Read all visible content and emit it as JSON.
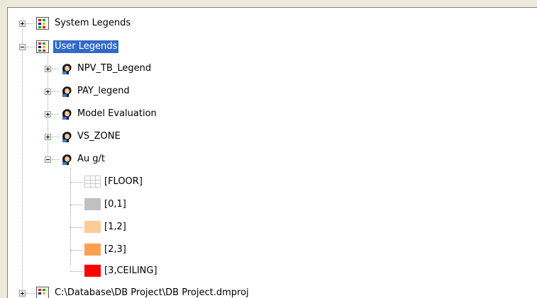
{
  "tree": {
    "system_legends": "System Legends",
    "user_legends": "User Legends",
    "legends": [
      {
        "label": "NPV_TB_Legend",
        "expanded": false
      },
      {
        "label": "PAY_legend",
        "expanded": false
      },
      {
        "label": "Model Evaluation",
        "expanded": false
      },
      {
        "label": "VS_ZONE",
        "expanded": false
      },
      {
        "label": "Au g/t",
        "expanded": true
      }
    ],
    "au_ranges": [
      {
        "label": "[FLOOR]",
        "color": "#ffffff",
        "pattern": "grid"
      },
      {
        "label": "[0,1]",
        "color": "#c0c0c0"
      },
      {
        "label": "[1,2]",
        "color": "#ffcc99"
      },
      {
        "label": "[2,3]",
        "color": "#ffa050"
      },
      {
        "label": "[3,CEILING]",
        "color": "#ff0000"
      }
    ],
    "project_path": "C:\\Database\\DB Project\\DB Project.dmproj"
  },
  "icons": {
    "folder": "legend-folder-icon",
    "legend": "user-legend-icon"
  }
}
